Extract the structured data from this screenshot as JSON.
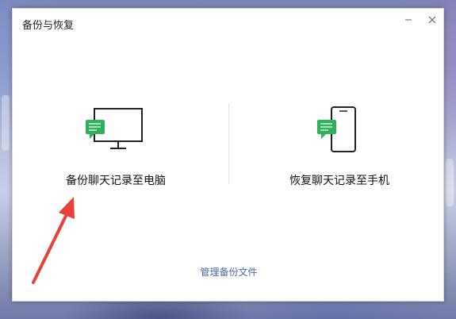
{
  "dialog": {
    "title": "备份与恢复",
    "minimize_icon": "minimize-icon",
    "close_icon": "close-icon"
  },
  "options": {
    "backup_to_pc": {
      "label": "备份聊天记录至电脑",
      "icon": "monitor-chat-icon"
    },
    "restore_to_phone": {
      "label": "恢复聊天记录至手机",
      "icon": "phone-chat-icon"
    }
  },
  "manage_link": "管理备份文件",
  "colors": {
    "chat_bubble": "#2fb15a",
    "link": "#4a6a9a",
    "annotation_arrow": "#e8413a"
  }
}
